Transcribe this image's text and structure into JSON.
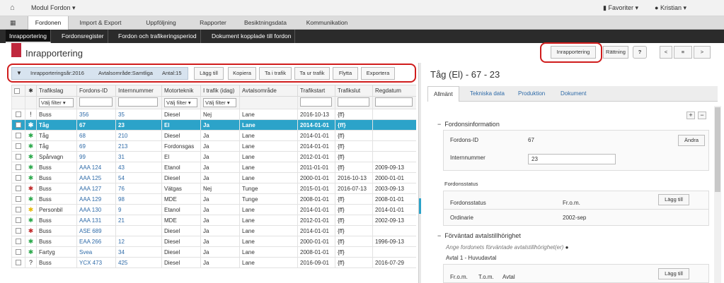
{
  "topbar": {
    "home_icon": "home-icon",
    "module": "Modul Fordon",
    "favoriter": "Favoriter",
    "user": "Kristian"
  },
  "tabs": [
    "Fordonen",
    "Import & Export",
    "Uppföljning",
    "Rapporter",
    "Besiktningsdata",
    "Kommunikation"
  ],
  "subtabs": [
    "Inrapportering",
    "Fordonsregister",
    "Fordon och trafikeringsperiod",
    "Dokument kopplade till fordon"
  ],
  "page": {
    "title": "Inrapportering",
    "btn_inrapportering": "Inrapportering",
    "btn_rattning": "Rättning",
    "help": "?",
    "nav_prev": "<",
    "nav_list": "≡",
    "nav_next": ">",
    "nav_end": "|"
  },
  "filter": {
    "year": "Inrapporteringsår:2016",
    "area": "Avtalsområde:Samtliga",
    "count": "Antal:15"
  },
  "toolbar": {
    "add": "Lägg till",
    "copy": "Kopiera",
    "to_traffic": "Ta i trafik",
    "from_traffic": "Ta ur trafik",
    "move": "Flytta",
    "export": "Exportera"
  },
  "table": {
    "headers": [
      "",
      "✱",
      "Trafikslag",
      "Fordons-ID",
      "Internnummer",
      "Motorteknik",
      "I trafik (idag)",
      "Avtalsområde",
      "Trafikstart",
      "Trafikslut",
      "Regdatum"
    ],
    "filter_placeholder": "Välj filter",
    "rows": [
      {
        "status": "!",
        "color": "k",
        "typ": "Buss",
        "fid": "356",
        "intern": "35",
        "motor": "Diesel",
        "itrafik": "Nej",
        "area": "Lane",
        "start": "2016-10-13",
        "slut": "{ff}",
        "reg": ""
      },
      {
        "status": "✱",
        "color": "g",
        "typ": "Tåg",
        "fid": "67",
        "intern": "23",
        "motor": "El",
        "itrafik": "Ja",
        "area": "Lane",
        "start": "2014-01-01",
        "slut": "{ff}",
        "reg": "",
        "selected": true
      },
      {
        "status": "✱",
        "color": "g",
        "typ": "Tåg",
        "fid": "68",
        "intern": "210",
        "motor": "Diesel",
        "itrafik": "Ja",
        "area": "Lane",
        "start": "2014-01-01",
        "slut": "{ff}",
        "reg": ""
      },
      {
        "status": "✱",
        "color": "g",
        "typ": "Tåg",
        "fid": "69",
        "intern": "213",
        "motor": "Fordonsgas",
        "itrafik": "Ja",
        "area": "Lane",
        "start": "2014-01-01",
        "slut": "{ff}",
        "reg": ""
      },
      {
        "status": "✱",
        "color": "g",
        "typ": "Spårvagn",
        "fid": "99",
        "intern": "31",
        "motor": "El",
        "itrafik": "Ja",
        "area": "Lane",
        "start": "2012-01-01",
        "slut": "{ff}",
        "reg": ""
      },
      {
        "status": "✱",
        "color": "g",
        "typ": "Buss",
        "fid": "AAA 124",
        "intern": "43",
        "motor": "Etanol",
        "itrafik": "Ja",
        "area": "Lane",
        "start": "2011-01-01",
        "slut": "{ff}",
        "reg": "2009-09-13"
      },
      {
        "status": "✱",
        "color": "g",
        "typ": "Buss",
        "fid": "AAA 125",
        "intern": "54",
        "motor": "Diesel",
        "itrafik": "Ja",
        "area": "Lane",
        "start": "2000-01-01",
        "slut": "2016-10-13",
        "reg": "2000-01-01"
      },
      {
        "status": "✱",
        "color": "r",
        "typ": "Buss",
        "fid": "AAA 127",
        "intern": "76",
        "motor": "Vätgas",
        "itrafik": "Nej",
        "area": "Tunge",
        "start": "2015-01-01",
        "slut": "2016-07-13",
        "reg": "2003-09-13"
      },
      {
        "status": "✱",
        "color": "g",
        "typ": "Buss",
        "fid": "AAA 129",
        "intern": "98",
        "motor": "MDE",
        "itrafik": "Ja",
        "area": "Tunge",
        "start": "2008-01-01",
        "slut": "{ff}",
        "reg": "2008-01-01"
      },
      {
        "status": "✱",
        "color": "y",
        "typ": "Personbil",
        "fid": "AAA 130",
        "intern": "9",
        "motor": "Etanol",
        "itrafik": "Ja",
        "area": "Lane",
        "start": "2014-01-01",
        "slut": "{ff}",
        "reg": "2014-01-01"
      },
      {
        "status": "✱",
        "color": "g",
        "typ": "Buss",
        "fid": "AAA 131",
        "intern": "21",
        "motor": "MDE",
        "itrafik": "Ja",
        "area": "Lane",
        "start": "2012-01-01",
        "slut": "{ff}",
        "reg": "2002-09-13"
      },
      {
        "status": "✱",
        "color": "r",
        "typ": "Buss",
        "fid": "ASE 689",
        "intern": "",
        "motor": "Diesel",
        "itrafik": "Ja",
        "area": "Lane",
        "start": "2014-01-01",
        "slut": "{ff}",
        "reg": ""
      },
      {
        "status": "✱",
        "color": "g",
        "typ": "Buss",
        "fid": "EAA 266",
        "intern": "12",
        "motor": "Diesel",
        "itrafik": "Ja",
        "area": "Lane",
        "start": "2000-01-01",
        "slut": "{ff}",
        "reg": "1996-09-13"
      },
      {
        "status": "✱",
        "color": "g",
        "typ": "Fartyg",
        "fid": "Svea",
        "intern": "34",
        "motor": "Diesel",
        "itrafik": "Ja",
        "area": "Lane",
        "start": "2008-01-01",
        "slut": "{ff}",
        "reg": ""
      },
      {
        "status": "?",
        "color": "k",
        "typ": "Buss",
        "fid": "YCX 473",
        "intern": "425",
        "motor": "Diesel",
        "itrafik": "Ja",
        "area": "Lane",
        "start": "2016-09-01",
        "slut": "{ff}",
        "reg": "2016-07-29"
      }
    ]
  },
  "detail": {
    "title": "Tåg (El) - 67 - 23",
    "tabs": [
      "Allmänt",
      "Tekniska data",
      "Produktion",
      "Dokument"
    ],
    "plus": "+",
    "minus": "−",
    "sect_fordonsinfo": "Fordonsinformation",
    "lbl_fid": "Fordons-ID",
    "val_fid": "67",
    "btn_andra": "Ändra",
    "lbl_intern": "Internnummer",
    "val_intern": "23",
    "lbl_fordonsstatus_title": "Fordonsstatus",
    "col_status": "Fordonsstatus",
    "col_from": "Fr.o.m.",
    "btn_lagg": "Lägg till",
    "status_val": "Ordinarie",
    "status_from": "2002-sep",
    "sect_avtal": "Förväntad avtalstillhörighet",
    "avtal_hint": "Ange fordonets förväntade avtalstillhörighet(er)",
    "avtal1": "Avtal 1 - Huvudavtal",
    "col_from2": "Fr.o.m.",
    "col_tom": "T.o.m.",
    "col_avtal": "Avtal",
    "btn_lagg2": "Lägg till"
  }
}
